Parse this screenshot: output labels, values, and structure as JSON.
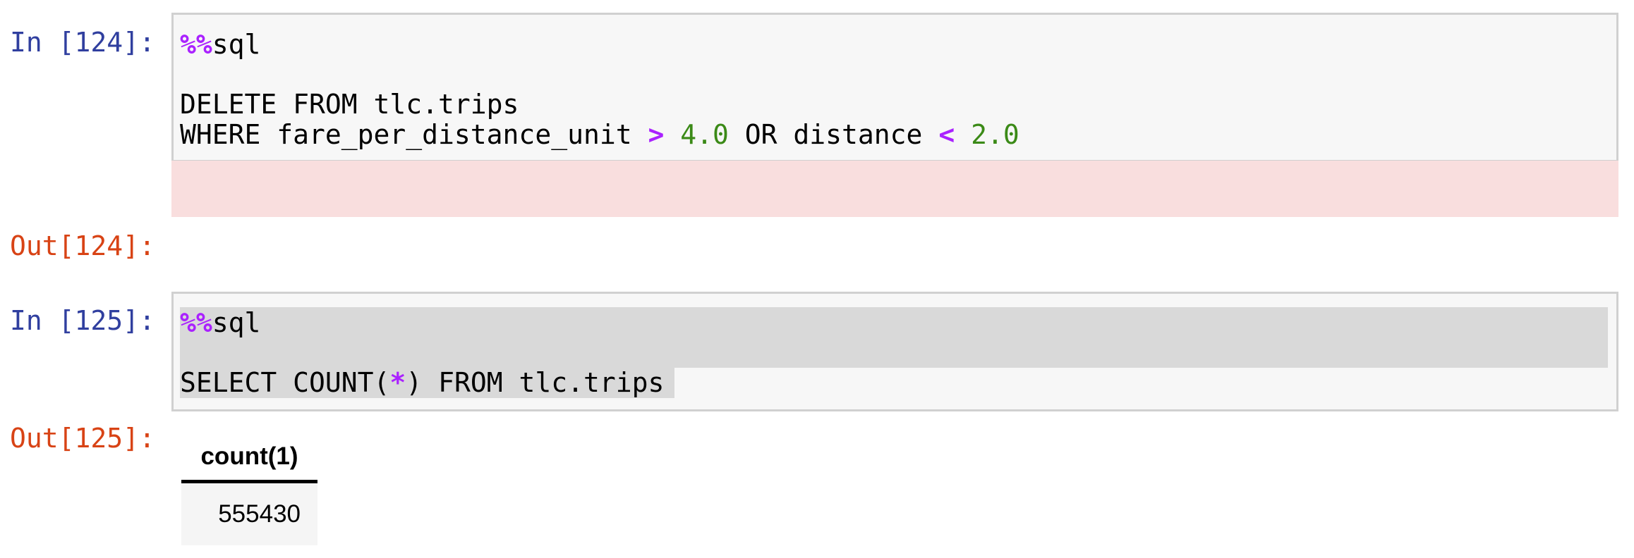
{
  "cells": [
    {
      "in_prompt": "In [124]:",
      "out_prompt": "Out[124]:",
      "magic": "%%",
      "magic_cmd": "sql",
      "line2_kw1": "DELETE FROM tlc.trips",
      "line3_a": "WHERE fare_per_distance_unit ",
      "line3_op1": ">",
      "line3_num1": "4.0",
      "line3_b": " OR distance ",
      "line3_op2": "<",
      "line3_num2": "2.0"
    },
    {
      "in_prompt": "In [125]:",
      "out_prompt": "Out[125]:",
      "magic": "%%",
      "magic_cmd": "sql",
      "line2_a": "SELECT COUNT(",
      "line2_op": "*",
      "line2_b": ") FROM tlc.trips"
    }
  ],
  "result_table": {
    "header": "count(1)",
    "rows": [
      "555430"
    ]
  },
  "colors": {
    "in_prompt": "#303f9f",
    "out_prompt": "#d84315",
    "magic": "#aa22ff",
    "number": "#3b8a17",
    "error_background": "#f9dede"
  }
}
